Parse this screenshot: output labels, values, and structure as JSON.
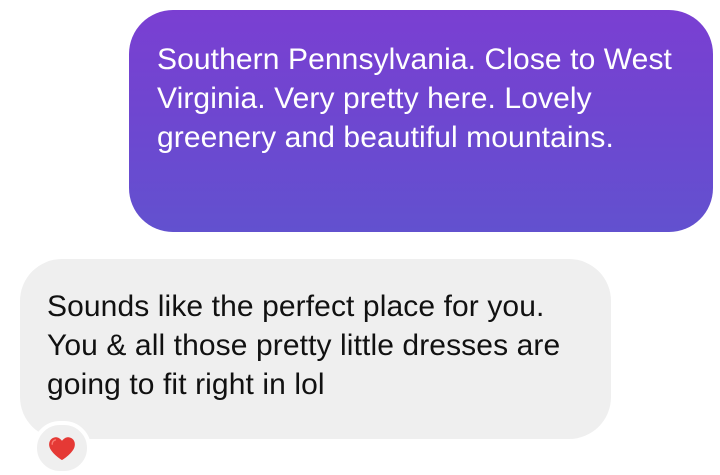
{
  "conversation": {
    "messages": [
      {
        "sender": "me",
        "text": "Southern Pennsylvania. Close to West Virginia. Very pretty here. Lovely greenery and beautiful mountains."
      },
      {
        "sender": "other",
        "text": "Sounds like the perfect place for you. You & all those pretty little dresses are going to fit right in lol",
        "reaction": {
          "icon": "red-heart-icon",
          "color": "#e53935"
        }
      }
    ]
  },
  "colors": {
    "outgoing_gradient_top": "#7a3fd2",
    "outgoing_gradient_bottom": "#6251cf",
    "incoming_bubble": "#efefef",
    "incoming_text": "#111111",
    "outgoing_text": "#ffffff"
  }
}
